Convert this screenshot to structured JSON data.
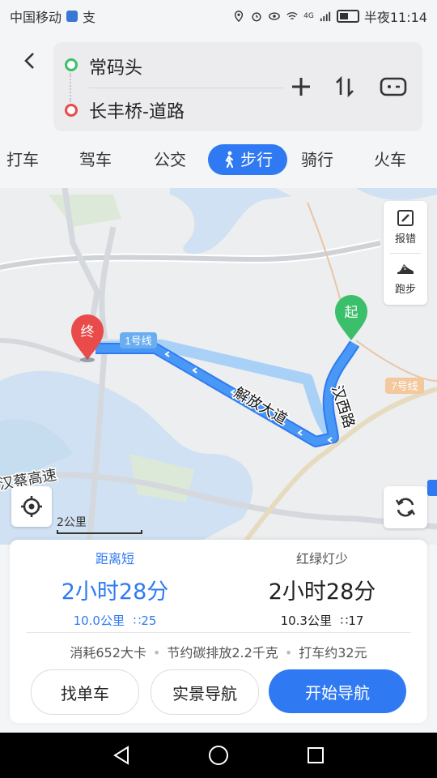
{
  "status_bar": {
    "carrier": "中国移动",
    "carrier_extra": "支",
    "network": "4G",
    "time": "半夜11:14"
  },
  "route": {
    "start": "常码头",
    "end": "长丰桥-道路"
  },
  "tabs": [
    "打车",
    "驾车",
    "公交",
    "步行",
    "骑行",
    "火车"
  ],
  "map": {
    "tools": {
      "report": "报错",
      "run": "跑步"
    },
    "labels": {
      "metro1": "1号线",
      "metro7": "7号线",
      "road_jiefang": "解放大道",
      "road_hanxi": "汉西路",
      "highway": "汉蔡高速",
      "end_pin": "终",
      "start_pin": "起"
    },
    "scale": "2公里"
  },
  "routes": [
    {
      "tag": "距离短",
      "time": "2小时28分",
      "distance": "10.0公里",
      "lights": "25"
    },
    {
      "tag": "红绿灯少",
      "time": "2小时28分",
      "distance": "10.3公里",
      "lights": "17"
    }
  ],
  "stats": {
    "calories": "消耗652大卡",
    "carbon": "节约碳排放2.2千克",
    "taxi": "打车约32元"
  },
  "buttons": {
    "bike": "找单车",
    "ar": "实景导航",
    "start": "开始导航"
  },
  "colors": {
    "accent": "#2f7af2",
    "route": "#3a8fe8",
    "alt_route": "#a9d1f7",
    "start_pin": "#3bbf6a",
    "end_pin": "#e94a4a"
  }
}
